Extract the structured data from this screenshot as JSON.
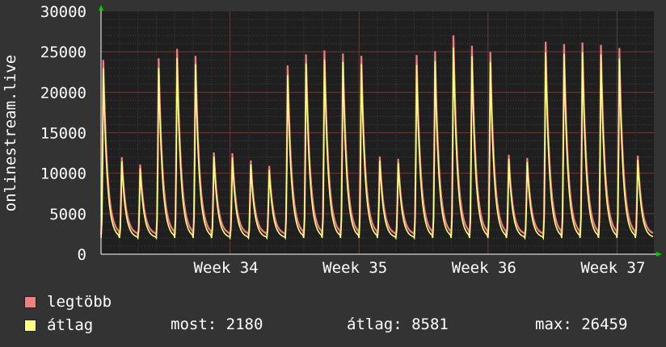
{
  "chart_data": {
    "type": "line",
    "ylabel": "onlinestream.live",
    "ylim": [
      0,
      30000
    ],
    "y_ticks": [
      0,
      5000,
      10000,
      15000,
      20000,
      25000,
      30000
    ],
    "x_ticks": [
      {
        "label": "Week 34",
        "day": 7
      },
      {
        "label": "Week 35",
        "day": 14
      },
      {
        "label": "Week 36",
        "day": 21
      },
      {
        "label": "Week 37",
        "day": 28
      }
    ],
    "grid": true,
    "colors": {
      "max": "#f07f7f",
      "avg": "#ffff80",
      "background": "#333333",
      "plot": "#1f1f1f",
      "grid": "#5a3a3a"
    },
    "daily_peaks_max": [
      24500,
      12200,
      11300,
      24700,
      25900,
      25000,
      12800,
      12700,
      11800,
      11100,
      23800,
      25200,
      25700,
      25300,
      25000,
      12300,
      12000,
      25100,
      25600,
      27600,
      26300,
      25500,
      12500,
      12100,
      26800,
      26500,
      26700,
      26400,
      26000,
      12400
    ],
    "daily_peaks_avg": [
      23500,
      11700,
      10800,
      23500,
      24800,
      24000,
      12300,
      12200,
      11300,
      10600,
      22600,
      24100,
      24600,
      24300,
      24000,
      11800,
      11500,
      23900,
      24400,
      26100,
      25000,
      24300,
      12000,
      11600,
      25500,
      25300,
      25500,
      25200,
      24700,
      11900
    ],
    "series": [
      {
        "name": "legtöbb",
        "color": "#f07f7f"
      },
      {
        "name": "átlag",
        "color": "#ffff80"
      }
    ]
  },
  "legend": {
    "max_label": "legtöbb",
    "avg_label": "átlag"
  },
  "stats": {
    "current": "most: 2180",
    "average": "átlag: 8581",
    "maximum": "max: 26459"
  }
}
